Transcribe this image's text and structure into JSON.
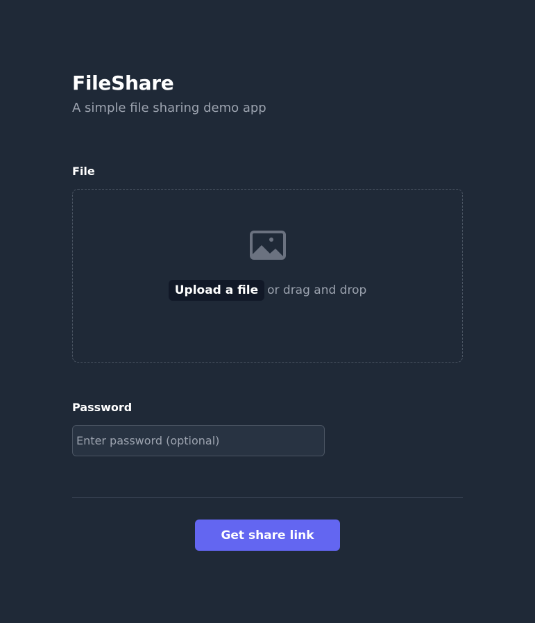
{
  "header": {
    "title": "FileShare",
    "subtitle": "A simple file sharing demo app"
  },
  "file_field": {
    "label": "File",
    "icon": "image-icon",
    "upload_link": "Upload a file",
    "drag_text": "or drag and drop"
  },
  "password_field": {
    "label": "Password",
    "placeholder": "Enter password (optional)",
    "value": ""
  },
  "actions": {
    "submit_label": "Get share link"
  },
  "colors": {
    "background": "#1f2937",
    "accent": "#6366f1",
    "muted_text": "#9ca3af",
    "border": "#4b5563"
  }
}
